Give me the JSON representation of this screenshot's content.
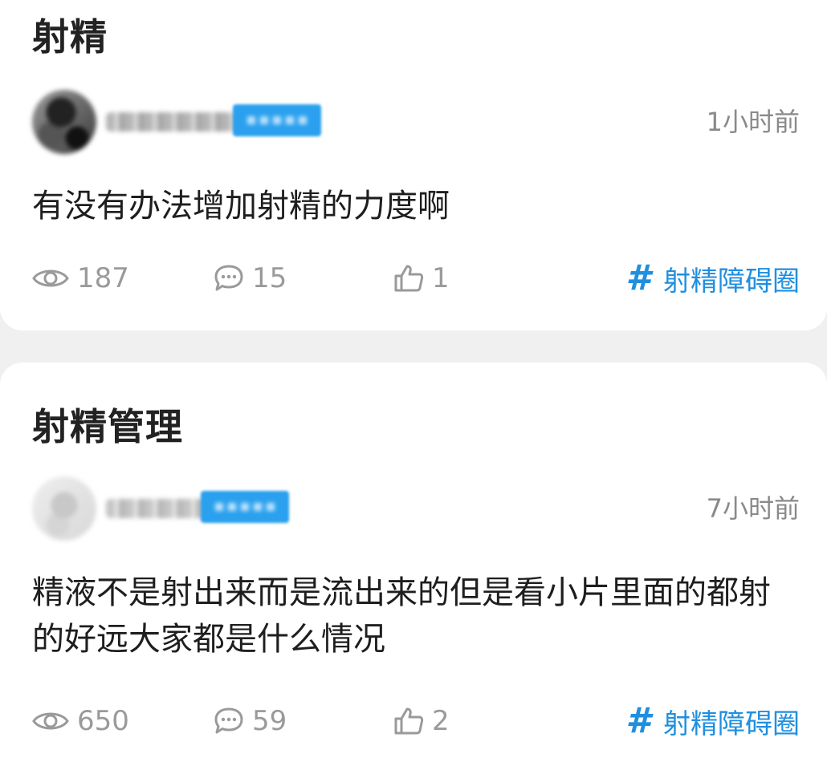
{
  "posts": [
    {
      "title": "射精",
      "time": "1小时前",
      "body": "有没有办法增加射精的力度啊",
      "stats": {
        "views": "187",
        "comments": "15",
        "likes": "1"
      },
      "topic": {
        "hash": "#",
        "label": "射精障碍圈"
      }
    },
    {
      "title": "射精管理",
      "time": "7小时前",
      "body": "精液不是射出来而是流出来的但是看小片里面的都射的好远大家都是什么情况",
      "stats": {
        "views": "650",
        "comments": "59",
        "likes": "2"
      },
      "topic": {
        "hash": "#",
        "label": "射精障碍圈"
      }
    }
  ],
  "colors": {
    "topic": "#1f8fe0",
    "badge": "#2aa0ee",
    "stat_text": "#9a9a9a",
    "time_text": "#8a8a8a",
    "feed_background": "#f0f0f0"
  },
  "icons": {
    "views": "eye-icon",
    "comments": "comment-bubble-icon",
    "likes": "thumbs-up-icon"
  }
}
